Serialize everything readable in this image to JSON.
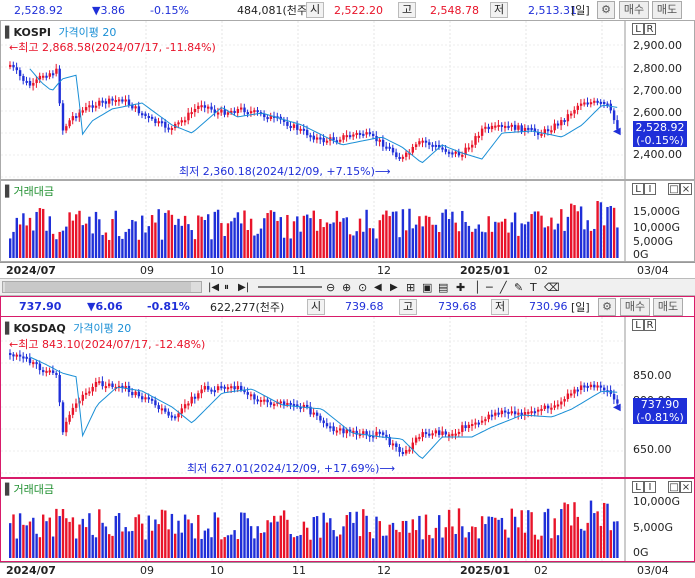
{
  "kospi": {
    "price": "2,528.92",
    "change": "▼3.86",
    "change_pct": "-0.15%",
    "volume": "484,081(천주)",
    "open_label": "시",
    "open": "2,522.20",
    "high_label": "고",
    "high": "2,548.78",
    "low_label": "저",
    "low": "2,513.31",
    "period": "[일]",
    "buy_label": "매수",
    "sell_label": "매도",
    "name": "KOSPI",
    "indicator": "가격이평 20",
    "high_note": "←최고 2,868.58(2024/07/17, -11.84%)",
    "low_note": "최저 2,360.18(2024/12/09, +7.15%)⟶",
    "yticks": [
      "2,900.00",
      "2,800.00",
      "2,700.00",
      "2,600.00",
      "2,400.00"
    ],
    "cur_tag": "2,528.92",
    "cur_tag_pct": "(-0.15%)",
    "vol_title": "거래대금",
    "vol_ticks": [
      "15,000G",
      "10,000G",
      "5,000G",
      "0G"
    ]
  },
  "kosdaq": {
    "price": "737.90",
    "change": "▼6.06",
    "change_pct": "-0.81%",
    "volume": "622,277(천주)",
    "open_label": "시",
    "open": "739.68",
    "high_label": "고",
    "high": "739.68",
    "low_label": "저",
    "low": "730.96",
    "period": "[일]",
    "buy_label": "매수",
    "sell_label": "매도",
    "name": "KOSDAQ",
    "indicator": "가격이평 20",
    "high_note": "←최고 843.10(2024/07/17, -12.48%)",
    "low_note": "최저 627.01(2024/12/09, +17.69%)⟶",
    "yticks": [
      "850.00",
      "800.00",
      "650.00"
    ],
    "cur_tag": "737.90",
    "cur_tag_pct": "(-0.81%)",
    "vol_title": "거래대금",
    "vol_ticks": [
      "10,000G",
      "5,000G",
      "0G"
    ]
  },
  "xaxis": [
    "2024/07",
    "09",
    "10",
    "11",
    "12",
    "2025/01",
    "02",
    "03/04"
  ],
  "colors": {
    "up": "#e8142a",
    "down": "#1f2fd8",
    "ma": "#1a8fd6",
    "accent": "#d81b6a"
  }
}
